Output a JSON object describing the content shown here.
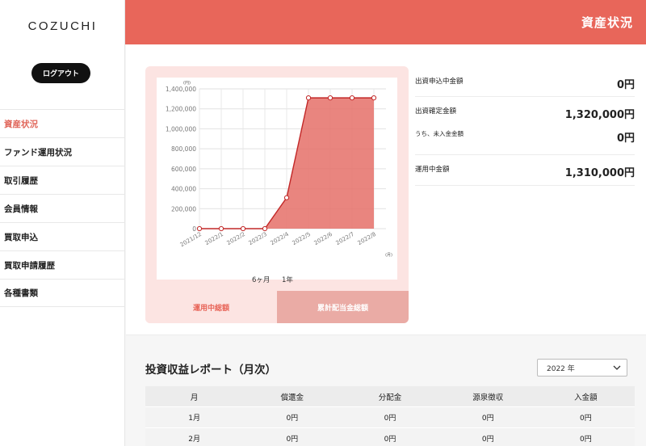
{
  "app": {
    "logo": "COZUCHI",
    "logout_label": "ログアウト"
  },
  "header": {
    "title": "資産状況"
  },
  "nav": {
    "items": [
      {
        "label": "資産状況",
        "active": true
      },
      {
        "label": "ファンド運用状況"
      },
      {
        "label": "取引履歴"
      },
      {
        "label": "会員情報"
      },
      {
        "label": "買取申込"
      },
      {
        "label": "買取申請履歴"
      },
      {
        "label": "各種書類"
      }
    ]
  },
  "chart_tabs": {
    "range_6m": "6ヶ月",
    "range_1y": "1年",
    "tab_operating": "運用中総額",
    "tab_dividend": "累計配当金総額"
  },
  "summary": {
    "applied_label": "出資申込中金額",
    "applied_value": "0円",
    "confirmed_label": "出資確定金額",
    "confirmed_value": "1,320,000円",
    "unpaid_label": "うち、未入金金額",
    "unpaid_value": "0円",
    "operating_label": "運用中金額",
    "operating_value": "1,310,000円"
  },
  "report": {
    "title": "投資収益レポート（月次）",
    "year": "2022 年",
    "columns": [
      "月",
      "償還金",
      "分配金",
      "源泉徴収",
      "入金額"
    ],
    "rows": [
      [
        "1月",
        "0円",
        "0円",
        "0円",
        "0円"
      ],
      [
        "2月",
        "0円",
        "0円",
        "0円",
        "0円"
      ]
    ]
  },
  "colors": {
    "accent": "#e8665a",
    "fill": "#e57068",
    "line": "#c22828"
  },
  "chart_data": {
    "type": "area",
    "y_unit": "(円)",
    "x_unit": "(月)",
    "categories": [
      "2021/12",
      "2022/1",
      "2022/2",
      "2022/3",
      "2022/4",
      "2022/5",
      "2022/6",
      "2022/7",
      "2022/8"
    ],
    "values": [
      0,
      0,
      0,
      0,
      310000,
      1310000,
      1310000,
      1310000,
      1310000
    ],
    "y_ticks": [
      "0",
      "200,000",
      "400,000",
      "600,000",
      "800,000",
      "1,000,000",
      "1,200,000",
      "1,400,000"
    ],
    "ylim": [
      0,
      1400000
    ],
    "grid": true
  }
}
